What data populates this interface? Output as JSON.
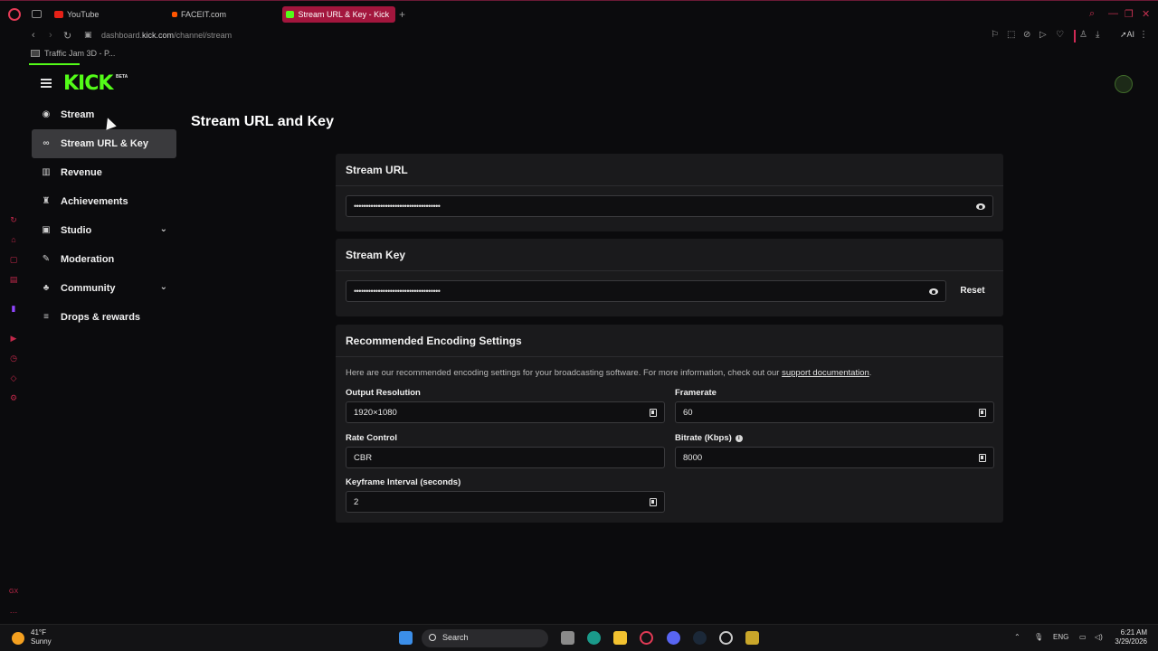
{
  "browser": {
    "tabs": [
      {
        "label": "YouTube",
        "favicon_color": "#e62117"
      },
      {
        "label": "FACEIT.com",
        "favicon_color": "#ff5500"
      },
      {
        "label": "Stream URL & Key - Kick D",
        "favicon_color": "#53fc18",
        "active": true
      }
    ],
    "url_prefix": "dashboard.",
    "url_domain": "kick.com",
    "url_path": "/channel/stream",
    "ai_label": "AI",
    "bookmark": "Traffic Jam 3D - P..."
  },
  "brand": {
    "logo": "KICK",
    "beta": "BETA",
    "accent": "#53fc18"
  },
  "sidebar": {
    "items": [
      {
        "label": "Stream",
        "icon": "broadcast-icon",
        "glyph": "◉"
      },
      {
        "label": "Stream URL & Key",
        "icon": "link-icon",
        "glyph": "∞",
        "active": true
      },
      {
        "label": "Revenue",
        "icon": "chart-icon",
        "glyph": "▥"
      },
      {
        "label": "Achievements",
        "icon": "trophy-icon",
        "glyph": "♜"
      },
      {
        "label": "Studio",
        "icon": "studio-icon",
        "glyph": "▣",
        "expandable": true
      },
      {
        "label": "Moderation",
        "icon": "wrench-icon",
        "glyph": "✎"
      },
      {
        "label": "Community",
        "icon": "community-icon",
        "glyph": "♣",
        "expandable": true
      },
      {
        "label": "Drops & rewards",
        "icon": "drops-icon",
        "glyph": "≡"
      }
    ]
  },
  "main": {
    "title": "Stream URL and Key",
    "stream_url": {
      "title": "Stream URL",
      "masked": "••••••••••••••••••••••••••••••••••••"
    },
    "stream_key": {
      "title": "Stream Key",
      "masked": "••••••••••••••••••••••••••••••••••••",
      "reset": "Reset"
    },
    "encoding": {
      "title": "Recommended Encoding Settings",
      "description": "Here are our recommended encoding settings for your broadcasting software. For more information, check out our",
      "link": "support documentation",
      "desc_end": ".",
      "fields": {
        "output_resolution": {
          "label": "Output Resolution",
          "value": "1920×1080"
        },
        "framerate": {
          "label": "Framerate",
          "value": "60"
        },
        "rate_control": {
          "label": "Rate Control",
          "value": "CBR"
        },
        "bitrate": {
          "label": "Bitrate (Kbps)",
          "value": "8000"
        },
        "keyframe": {
          "label": "Keyframe Interval (seconds)",
          "value": "2"
        }
      }
    }
  },
  "taskbar": {
    "temp": "41°F",
    "condition": "Sunny",
    "search": "Search",
    "lang": "ENG",
    "time": "6:21 AM",
    "date": "3/29/2026"
  }
}
